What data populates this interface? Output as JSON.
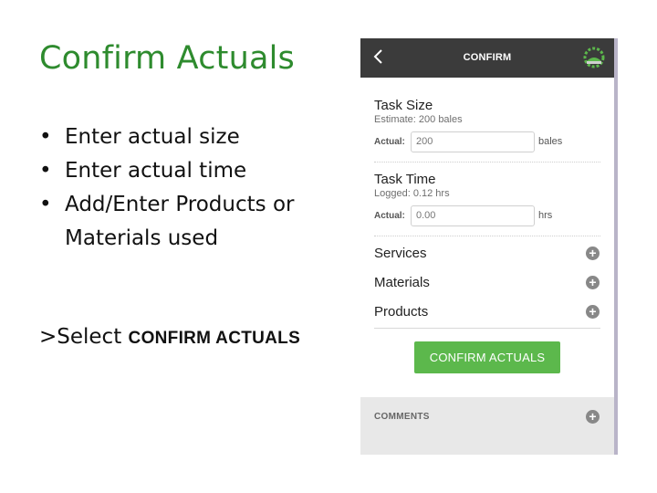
{
  "slide": {
    "title": "Confirm Actuals",
    "bullets": [
      "Enter actual size",
      "Enter actual time",
      "Add/Enter Products or Materials used"
    ],
    "select_prefix": ">Select ",
    "select_action": "CONFIRM ACTUALS"
  },
  "app": {
    "header": {
      "back_icon": "chevron-left-icon",
      "title": "CONFIRM",
      "logo_icon": "farm-logo-icon"
    },
    "task_size": {
      "title": "Task Size",
      "estimate": "Estimate: 200 bales",
      "actual_label": "Actual:",
      "actual_value": "200",
      "unit": "bales"
    },
    "task_time": {
      "title": "Task Time",
      "logged": "Logged: 0.12 hrs",
      "actual_label": "Actual:",
      "actual_value": "0.00",
      "unit": "hrs"
    },
    "sections": [
      "Services",
      "Materials",
      "Products"
    ],
    "confirm_button": "CONFIRM ACTUALS",
    "comments_label": "COMMENTS",
    "colors": {
      "header": "#3b3b3b",
      "confirm": "#5cb84c",
      "title_green": "#2e8b2e"
    }
  }
}
